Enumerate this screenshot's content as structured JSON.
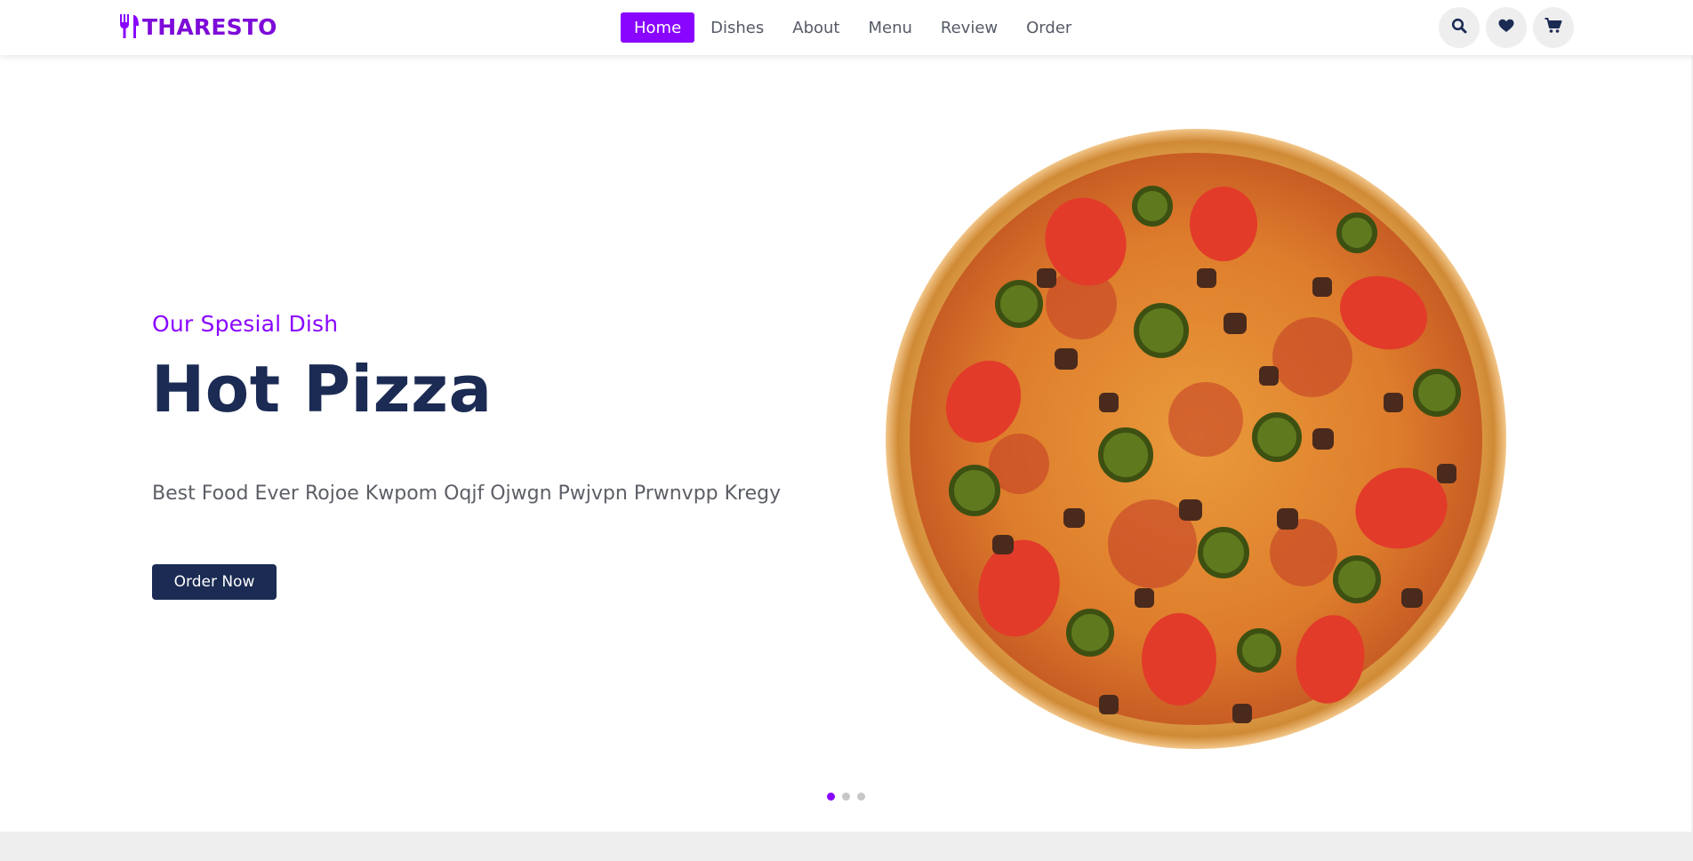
{
  "brand": {
    "name": "THARESTO",
    "color": "#8a05ff"
  },
  "header": {
    "nav": [
      {
        "label": "Home",
        "active": true
      },
      {
        "label": "Dishes",
        "active": false
      },
      {
        "label": "About",
        "active": false
      },
      {
        "label": "Menu",
        "active": false
      },
      {
        "label": "Review",
        "active": false
      },
      {
        "label": "Order",
        "active": false
      }
    ],
    "actions": [
      "search-icon",
      "heart-icon",
      "cart-icon"
    ]
  },
  "hero": {
    "subtitle": "Our Spesial Dish",
    "title": "Hot Pizza",
    "description": "Best Food Ever Rojoe Kwpom Oqjf Ojwgn Pwjvpn Prwnvpp Kregy",
    "cta": "Order Now",
    "image": "pizza",
    "slides": 3,
    "active_slide": 1
  },
  "colors": {
    "accent": "#8a05ff",
    "navy": "#1b2b53",
    "text": "#5c5f66",
    "muted": "#eeeeee"
  }
}
